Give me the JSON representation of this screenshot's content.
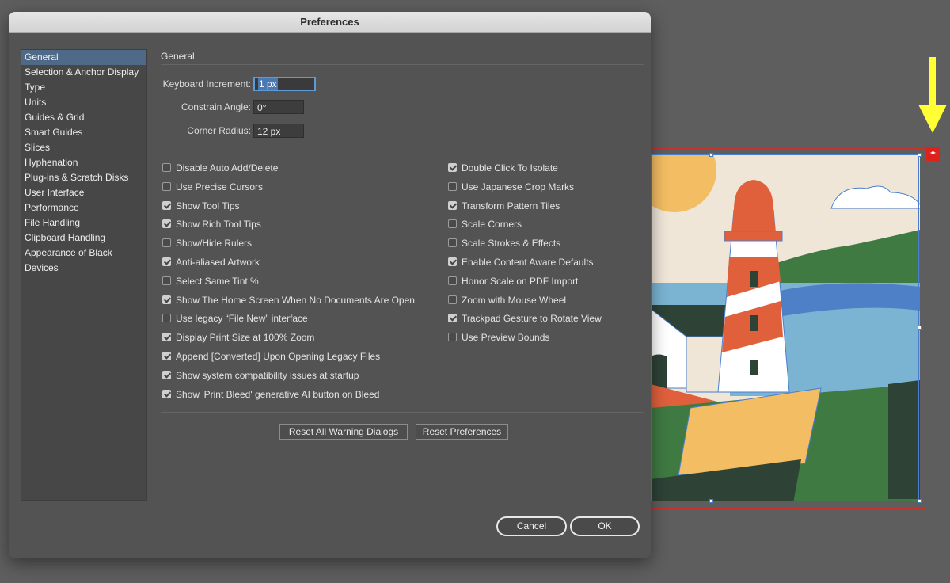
{
  "dialog": {
    "title": "Preferences",
    "sidebar": {
      "items": [
        {
          "label": "General",
          "selected": true
        },
        {
          "label": "Selection & Anchor Display"
        },
        {
          "label": "Type"
        },
        {
          "label": "Units"
        },
        {
          "label": "Guides & Grid"
        },
        {
          "label": "Smart Guides"
        },
        {
          "label": "Slices"
        },
        {
          "label": "Hyphenation"
        },
        {
          "label": "Plug-ins & Scratch Disks"
        },
        {
          "label": "User Interface"
        },
        {
          "label": "Performance"
        },
        {
          "label": "File Handling"
        },
        {
          "label": "Clipboard Handling"
        },
        {
          "label": "Appearance of Black"
        },
        {
          "label": "Devices"
        }
      ]
    },
    "section_title": "General",
    "fields": {
      "keyboard_increment": {
        "label": "Keyboard Increment:",
        "value": "1 px"
      },
      "constrain_angle": {
        "label": "Constrain Angle:",
        "value": "0°"
      },
      "corner_radius": {
        "label": "Corner Radius:",
        "value": "12 px"
      }
    },
    "left_checkboxes": [
      {
        "label": "Disable Auto Add/Delete",
        "checked": false
      },
      {
        "label": "Use Precise Cursors",
        "checked": false
      },
      {
        "label": "Show Tool Tips",
        "checked": true
      },
      {
        "label": "Show Rich Tool Tips",
        "checked": true
      },
      {
        "label": "Show/Hide Rulers",
        "checked": false
      },
      {
        "label": "Anti-aliased Artwork",
        "checked": true
      },
      {
        "label": "Select Same Tint %",
        "checked": false
      },
      {
        "label": "Show The Home Screen When No Documents Are Open",
        "checked": true
      },
      {
        "label": "Use legacy “File New” interface",
        "checked": false
      },
      {
        "label": "Display Print Size at 100% Zoom",
        "checked": true
      },
      {
        "label": "Append [Converted] Upon Opening Legacy Files",
        "checked": true
      },
      {
        "label": "Show system compatibility issues at startup",
        "checked": true
      },
      {
        "label": "Show 'Print Bleed' generative AI button on Bleed",
        "checked": true
      }
    ],
    "right_checkboxes": [
      {
        "label": "Double Click To Isolate",
        "checked": true
      },
      {
        "label": "Use Japanese Crop Marks",
        "checked": false
      },
      {
        "label": "Transform Pattern Tiles",
        "checked": true
      },
      {
        "label": "Scale Corners",
        "checked": false
      },
      {
        "label": "Scale Strokes & Effects",
        "checked": false
      },
      {
        "label": "Enable Content Aware Defaults",
        "checked": true
      },
      {
        "label": "Honor Scale on PDF Import",
        "checked": false
      },
      {
        "label": "Zoom with Mouse Wheel",
        "checked": false
      },
      {
        "label": "Trackpad Gesture to Rotate View",
        "checked": true
      },
      {
        "label": "Use Preview Bounds",
        "checked": false
      }
    ],
    "buttons": {
      "reset_warnings": "Reset All Warning Dialogs",
      "reset_prefs": "Reset Preferences",
      "cancel": "Cancel",
      "ok": "OK"
    }
  },
  "colors": {
    "annotation_arrow": "#ffff33",
    "selection_accent": "#4f6988",
    "bleed_border": "#c8302a"
  }
}
